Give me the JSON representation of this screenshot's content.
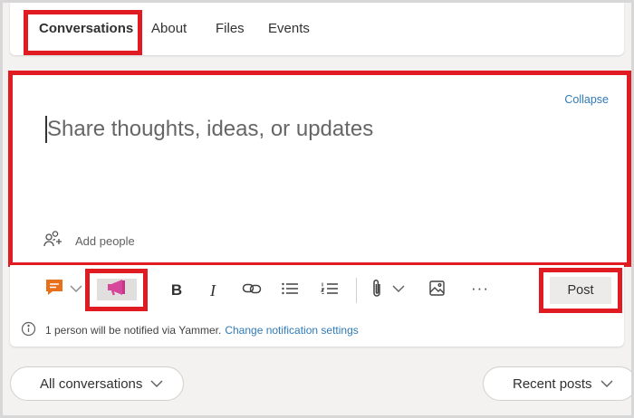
{
  "tabs": [
    {
      "label": "Conversations",
      "active": true
    },
    {
      "label": "About",
      "active": false
    },
    {
      "label": "Files",
      "active": false
    },
    {
      "label": "Events",
      "active": false
    }
  ],
  "composer": {
    "collapse_label": "Collapse",
    "placeholder": "Share thoughts, ideas, or updates",
    "value": "",
    "add_people_label": "Add people"
  },
  "toolbar": {
    "icons": [
      "message-type-icon",
      "chevron-down-icon",
      "announcement-icon",
      "bold-icon",
      "italic-icon",
      "link-icon",
      "bulleted-list-icon",
      "numbered-list-icon",
      "attachment-icon",
      "chevron-down-icon",
      "image-icon",
      "more-icon"
    ],
    "bold_glyph": "B",
    "italic_glyph": "I",
    "more_glyph": "···",
    "post_label": "Post"
  },
  "notification": {
    "text": "1 person will be notified via Yammer.",
    "link": "Change notification settings"
  },
  "filters": {
    "left_label": "All conversations",
    "right_label": "Recent posts"
  },
  "colors": {
    "highlight_border": "#e01b22",
    "link": "#2f7ab8",
    "message_icon": "#e8701a",
    "announcement_icon": "#d6479b",
    "post_button_bg": "#edebe9"
  }
}
